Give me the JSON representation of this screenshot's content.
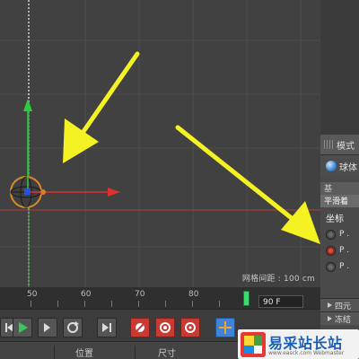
{
  "viewport": {
    "grid_spacing_label": "网格间距 : 100 cm"
  },
  "attributes": {
    "header": "模式",
    "object_name": "球体",
    "tabs": [
      "基",
      "平滑着"
    ],
    "section": "坐标",
    "params": [
      {
        "label": "P .",
        "active": false
      },
      {
        "label": "P .",
        "active": true
      },
      {
        "label": "P .",
        "active": false
      }
    ],
    "collapsed": [
      {
        "label": "四元"
      },
      {
        "label": "冻结"
      }
    ]
  },
  "timeline": {
    "ticks": [
      "50",
      "60",
      "70",
      "80"
    ],
    "current_frame": "90 F"
  },
  "bottom_panel": {
    "position_label": "位置",
    "size_label": "尺寸"
  },
  "watermark": {
    "text": "易采站长站",
    "subtext": "www.easck.com Webmaster"
  },
  "annotations": {
    "arrow_color": "#f5f224"
  }
}
